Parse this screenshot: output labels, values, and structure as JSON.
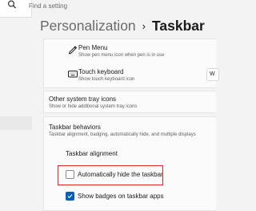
{
  "search": {
    "placeholder": "Find a setting"
  },
  "breadcrumb": {
    "parent": "Personalization",
    "separator": "›",
    "current": "Taskbar"
  },
  "pen_menu": {
    "title": "Pen Menu",
    "subtitle": "Show pen menu icon when pen is in use"
  },
  "touch_keyboard": {
    "title": "Touch keyboard",
    "subtitle": "Show touch keyboard icon",
    "dropdown_value": "W"
  },
  "other_tray": {
    "title": "Other system tray icons",
    "subtitle": "Show or hide additional system tray icons"
  },
  "behaviors": {
    "title": "Taskbar behaviors",
    "subtitle": "Taskbar alignment, badging, automatically hide, and multiple displays",
    "alignment_label": "Taskbar alignment",
    "auto_hide": {
      "label": "Automatically hide the taskbar",
      "checked": false
    },
    "badges": {
      "label": "Show badges on taskbar apps",
      "checked": true
    }
  },
  "colors": {
    "accent": "#005fb8",
    "highlight": "#e02828"
  }
}
